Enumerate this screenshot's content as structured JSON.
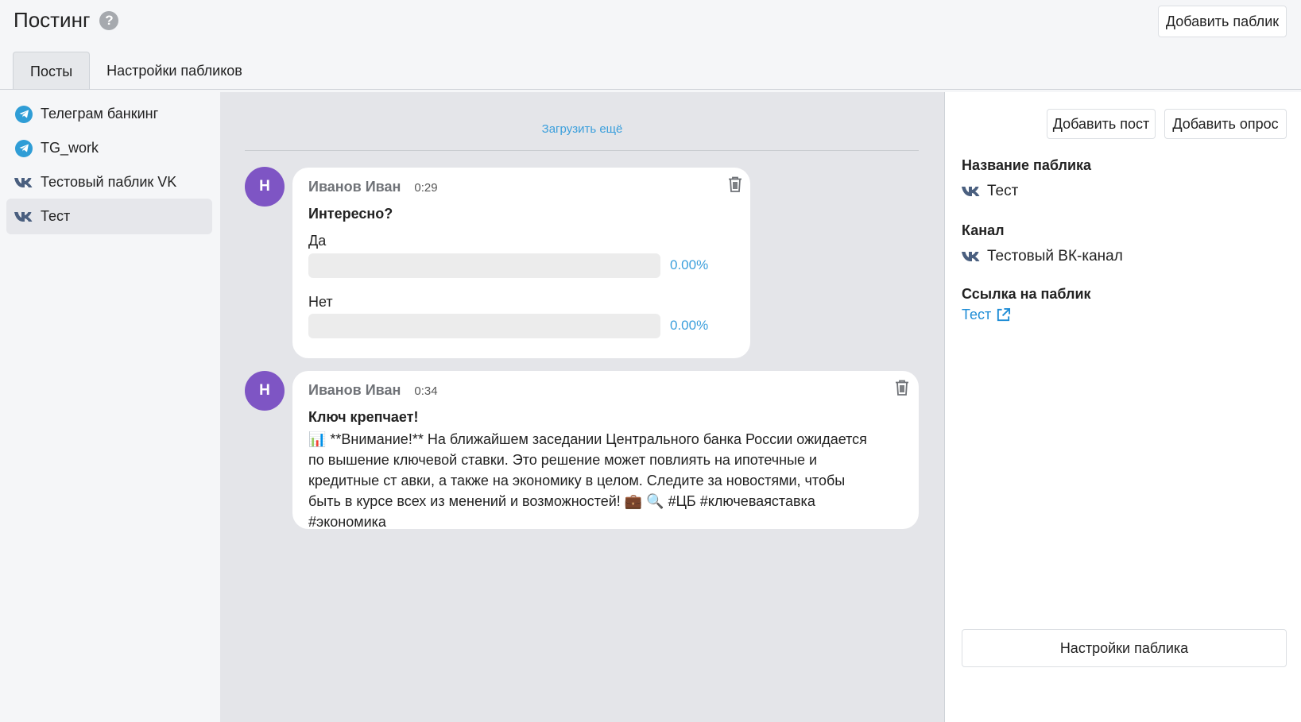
{
  "header": {
    "title": "Постинг",
    "help_icon": "?",
    "add_public_label": "Добавить паблик"
  },
  "tabs": [
    {
      "label": "Посты",
      "active": true
    },
    {
      "label": "Настройки пабликов",
      "active": false
    }
  ],
  "sidebar": {
    "items": [
      {
        "label": "Телеграм банкинг",
        "icon": "telegram-icon"
      },
      {
        "label": "TG_work",
        "icon": "telegram-icon"
      },
      {
        "label": "Тестовый паблик VK",
        "icon": "vk-icon"
      },
      {
        "label": "Тест",
        "icon": "vk-icon",
        "active": true
      }
    ]
  },
  "feed": {
    "load_more": "Загрузить ещё",
    "posts": [
      {
        "avatar": "Н",
        "author": "Иванов Иван",
        "time": "0:29",
        "title": "Интересно?",
        "poll": [
          {
            "label": "Да",
            "percent": "0.00%",
            "fraction": 0
          },
          {
            "label": "Нет",
            "percent": "0.00%",
            "fraction": 0
          }
        ]
      },
      {
        "avatar": "Н",
        "author": "Иванов Иван",
        "time": "0:34",
        "title": "Ключ крепчает!",
        "body": "📊 **Внимание!** На ближайшем заседании Центрального банка России ожидается по вышение ключевой ставки. Это решение может повлиять на ипотечные и кредитные ст авки, а также на экономику в целом. Следите за новостями, чтобы быть в курсе всех из менений и возможностей! 💼 🔍 #ЦБ #ключеваяставка #экономика"
      }
    ]
  },
  "right_panel": {
    "add_post_label": "Добавить пост",
    "add_poll_label": "Добавить опрос",
    "public_name_label": "Название паблика",
    "public_name_value": "Тест",
    "channel_label": "Канал",
    "channel_value": "Тестовый ВК-канал",
    "link_label": "Ссылка на паблик",
    "link_value": "Тест",
    "settings_label": "Настройки паблика"
  },
  "colors": {
    "accent": "#3b9fdc",
    "avatar": "#7e55c4",
    "telegram": "#2f9dd6",
    "vk": "#4a5f7f"
  }
}
